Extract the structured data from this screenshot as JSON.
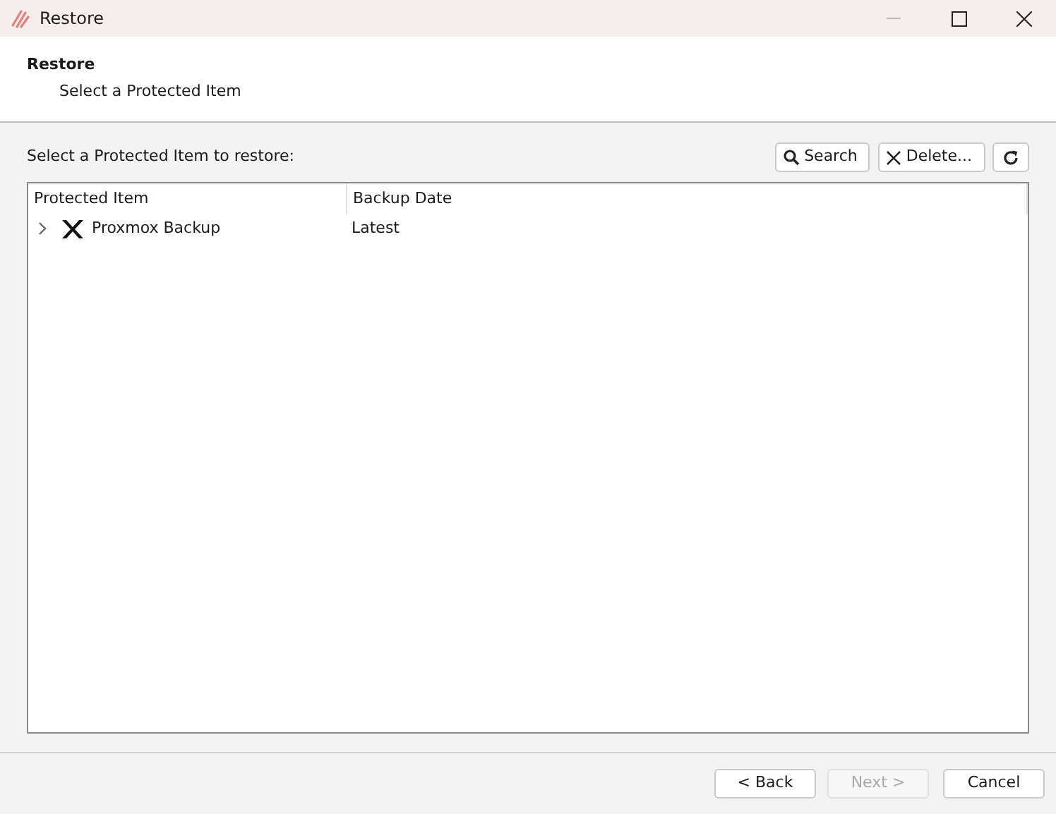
{
  "window": {
    "title": "Restore",
    "minimize_disabled": true
  },
  "header": {
    "title": "Restore",
    "subtitle": "Select a Protected Item"
  },
  "prompt": "Select a Protected Item to restore:",
  "toolbar": [
    {
      "kind": "search",
      "label": "Search"
    },
    {
      "kind": "delete",
      "label": "Delete..."
    },
    {
      "kind": "refresh"
    }
  ],
  "table": {
    "columns": [
      "Protected Item",
      "Backup Date"
    ],
    "rows": [
      {
        "name": "Proxmox Backup",
        "date": "Latest",
        "expanded": false
      }
    ]
  },
  "footer_buttons": [
    {
      "label": "< Back",
      "disabled": false
    },
    {
      "label": "Next >",
      "disabled": true
    },
    {
      "label": "Cancel",
      "disabled": false
    }
  ]
}
